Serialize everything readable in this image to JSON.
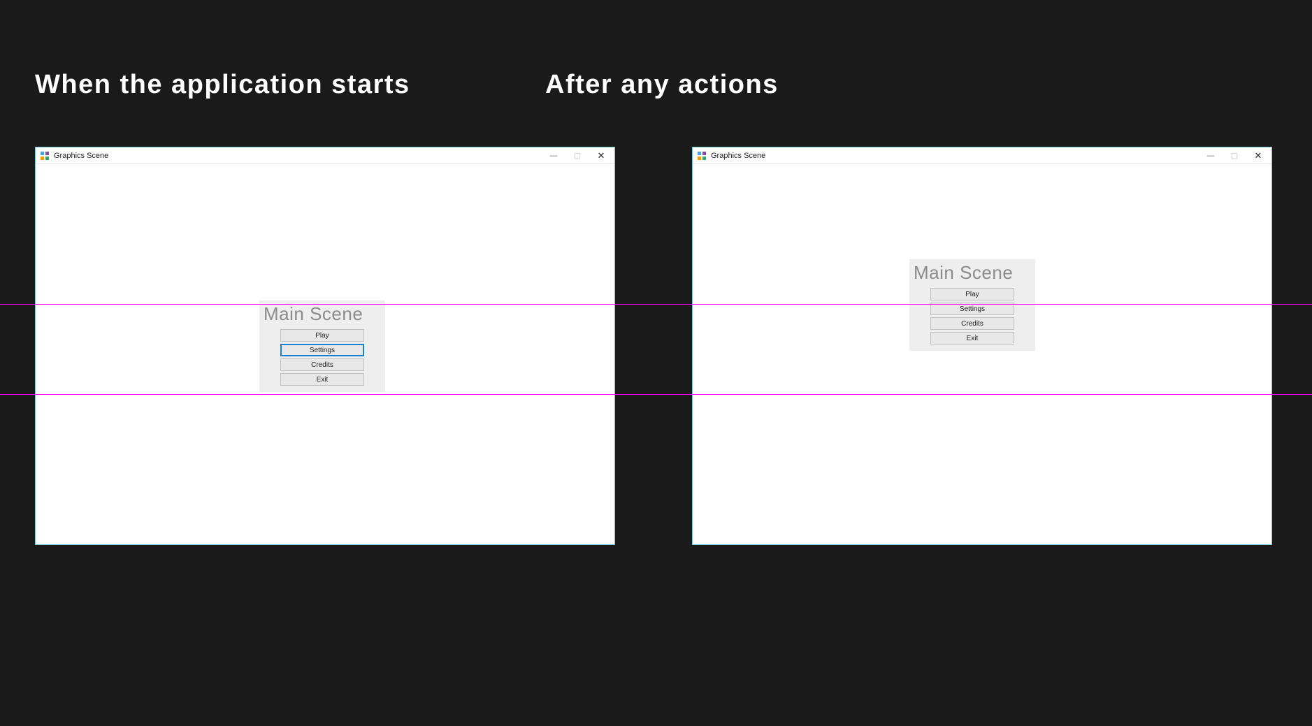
{
  "captions": {
    "left": "When the application starts",
    "right": "After any actions"
  },
  "window": {
    "title": "Graphics Scene"
  },
  "menu": {
    "title": "Main Scene",
    "buttons": {
      "play": "Play",
      "settings": "Settings",
      "credits": "Credits",
      "exit": "Exit"
    }
  }
}
